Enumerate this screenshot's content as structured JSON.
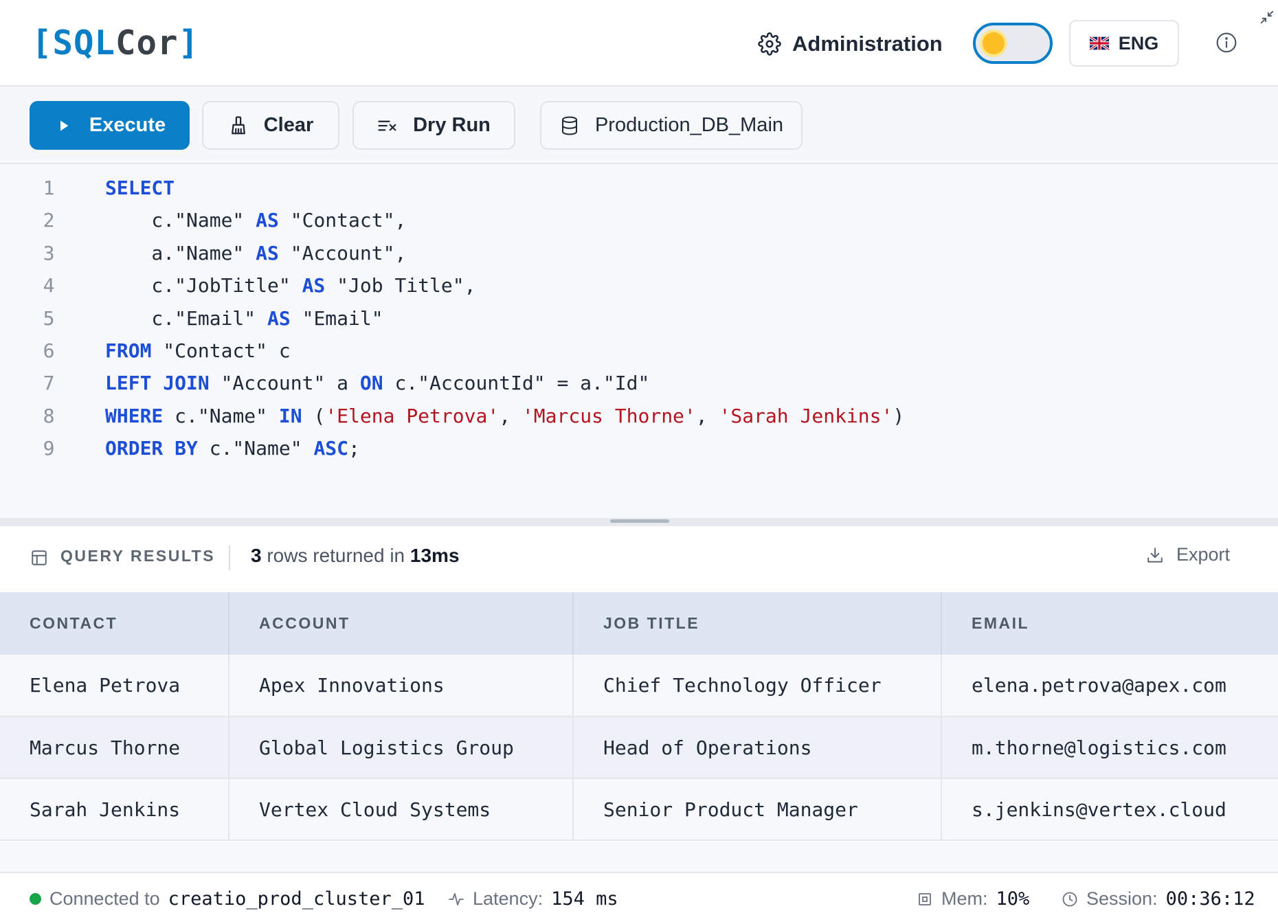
{
  "header": {
    "logo": {
      "bracket_open": "[",
      "sql": "SQL",
      "cor": "Cor",
      "bracket_close": "]"
    },
    "admin_label": "Administration",
    "theme_toggle": "light",
    "language": "ENG"
  },
  "toolbar": {
    "execute_label": "Execute",
    "clear_label": "Clear",
    "dry_run_label": "Dry Run",
    "database_label": "Production_DB_Main"
  },
  "editor": {
    "lines": [
      {
        "n": "1",
        "parts": [
          {
            "t": "kw",
            "v": "SELECT"
          }
        ]
      },
      {
        "n": "2",
        "parts": [
          {
            "t": "txt",
            "v": "    c.\"Name\" "
          },
          {
            "t": "kw",
            "v": "AS"
          },
          {
            "t": "txt",
            "v": " \"Contact\","
          }
        ]
      },
      {
        "n": "3",
        "parts": [
          {
            "t": "txt",
            "v": "    a.\"Name\" "
          },
          {
            "t": "kw",
            "v": "AS"
          },
          {
            "t": "txt",
            "v": " \"Account\","
          }
        ]
      },
      {
        "n": "4",
        "parts": [
          {
            "t": "txt",
            "v": "    c.\"JobTitle\" "
          },
          {
            "t": "kw",
            "v": "AS"
          },
          {
            "t": "txt",
            "v": " \"Job Title\","
          }
        ]
      },
      {
        "n": "5",
        "parts": [
          {
            "t": "txt",
            "v": "    c.\"Email\" "
          },
          {
            "t": "kw",
            "v": "AS"
          },
          {
            "t": "txt",
            "v": " \"Email\""
          }
        ]
      },
      {
        "n": "6",
        "parts": [
          {
            "t": "kw",
            "v": "FROM"
          },
          {
            "t": "txt",
            "v": " \"Contact\" c"
          }
        ]
      },
      {
        "n": "7",
        "parts": [
          {
            "t": "kw",
            "v": "LEFT JOIN"
          },
          {
            "t": "txt",
            "v": " \"Account\" a "
          },
          {
            "t": "kw",
            "v": "ON"
          },
          {
            "t": "txt",
            "v": " c.\"AccountId\" = a.\"Id\""
          }
        ]
      },
      {
        "n": "8",
        "parts": [
          {
            "t": "kw",
            "v": "WHERE"
          },
          {
            "t": "txt",
            "v": " c.\"Name\" "
          },
          {
            "t": "kw",
            "v": "IN"
          },
          {
            "t": "txt",
            "v": " ("
          },
          {
            "t": "str",
            "v": "'Elena Petrova'"
          },
          {
            "t": "txt",
            "v": ", "
          },
          {
            "t": "str",
            "v": "'Marcus Thorne'"
          },
          {
            "t": "txt",
            "v": ", "
          },
          {
            "t": "str",
            "v": "'Sarah Jenkins'"
          },
          {
            "t": "txt",
            "v": ")"
          }
        ]
      },
      {
        "n": "9",
        "parts": [
          {
            "t": "kw",
            "v": "ORDER BY"
          },
          {
            "t": "txt",
            "v": " c.\"Name\" "
          },
          {
            "t": "kw",
            "v": "ASC"
          },
          {
            "t": "txt",
            "v": ";"
          }
        ]
      }
    ]
  },
  "results": {
    "label": "QUERY RESULTS",
    "row_count": "3",
    "rows_text": " rows returned in ",
    "duration": "13ms",
    "export_label": "Export",
    "columns": [
      "CONTACT",
      "ACCOUNT",
      "JOB TITLE",
      "EMAIL"
    ],
    "rows": [
      [
        "Elena Petrova",
        "Apex Innovations",
        "Chief Technology Officer",
        "elena.petrova@apex.com"
      ],
      [
        "Marcus Thorne",
        "Global Logistics Group",
        "Head of Operations",
        "m.thorne@logistics.com"
      ],
      [
        "Sarah Jenkins",
        "Vertex Cloud Systems",
        "Senior Product Manager",
        "s.jenkins@vertex.cloud"
      ]
    ]
  },
  "status": {
    "connected_label": "Connected to",
    "cluster": "creatio_prod_cluster_01",
    "latency_label": "Latency:",
    "latency_value": "154 ms",
    "mem_label": "Mem:",
    "mem_value": "10%",
    "session_label": "Session:",
    "session_value": "00:36:12"
  },
  "colors": {
    "accent": "#0a7ec6",
    "keyword": "#1d4ed8",
    "string": "#b4141f",
    "status_ok": "#16a34a"
  },
  "icons": {
    "admin": "gear-icon",
    "execute": "play-icon",
    "clear": "broom-icon",
    "dry_run": "dry-run-icon",
    "database": "database-icon",
    "info": "info-icon",
    "collapse": "collapse-icon",
    "results": "table-icon",
    "export": "download-icon",
    "latency": "pulse-icon",
    "memory": "chip-icon",
    "session": "clock-icon"
  }
}
